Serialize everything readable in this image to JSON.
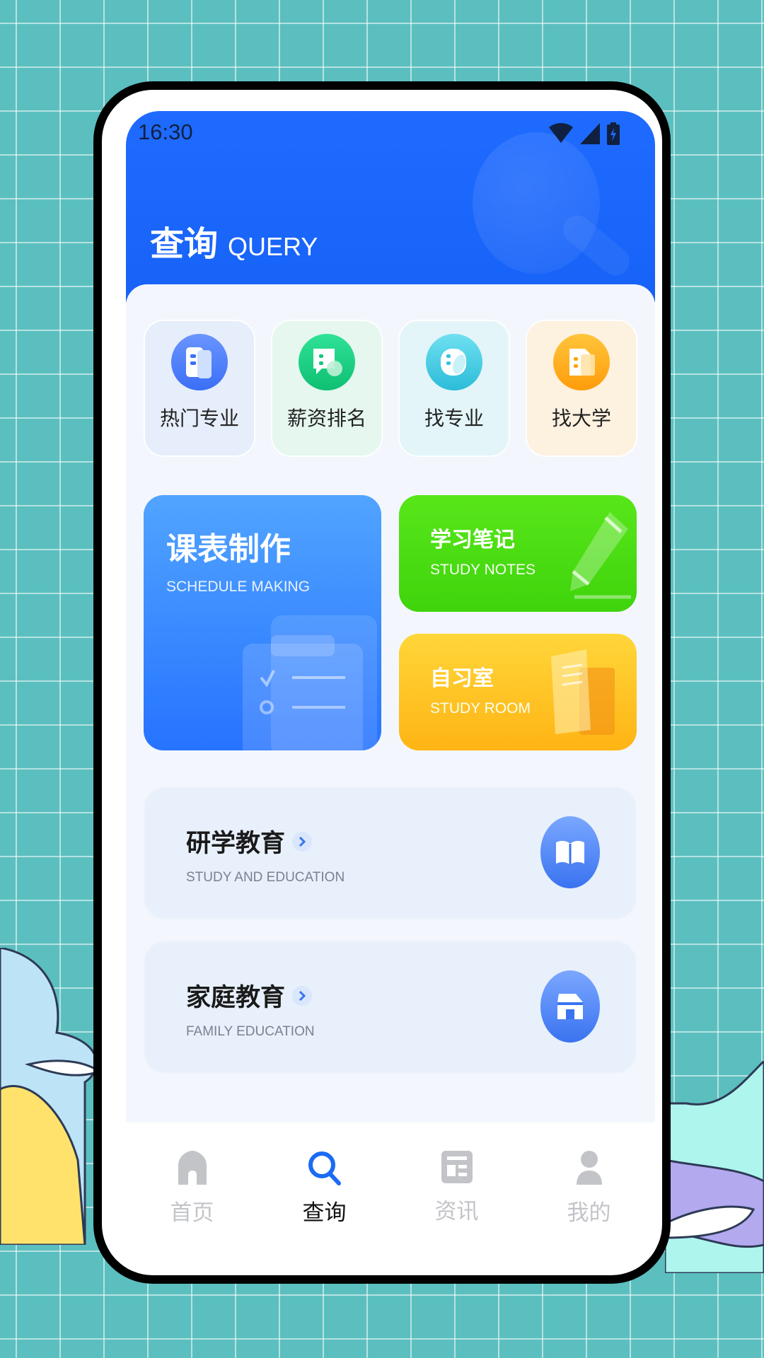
{
  "status_bar": {
    "time": "16:30",
    "icons": [
      "wifi-icon",
      "signal-icon",
      "battery-icon"
    ]
  },
  "header": {
    "title_cn": "查询",
    "title_en": "QUERY"
  },
  "quick_actions": [
    {
      "label": "热门专业",
      "icon": "book-icon",
      "color": "#3b6ff5",
      "bg": "#e6eefb"
    },
    {
      "label": "薪资排名",
      "icon": "chat-icon",
      "color": "#12c97a",
      "bg": "#e5f7ee"
    },
    {
      "label": "找专业",
      "icon": "capsule-icon",
      "color": "#34c6e0",
      "bg": "#e3f5f8"
    },
    {
      "label": "找大学",
      "icon": "building-icon",
      "color": "#ffa20f",
      "bg": "#fdf1df"
    }
  ],
  "features": {
    "schedule": {
      "title": "课表制作",
      "subtitle": "SCHEDULE MAKING",
      "icon": "clipboard-icon"
    },
    "notes": {
      "title": "学习笔记",
      "subtitle": "STUDY NOTES",
      "icon": "pencil-icon"
    },
    "room": {
      "title": "自习室",
      "subtitle": "STUDY ROOM",
      "icon": "door-icon"
    }
  },
  "list": [
    {
      "title": "研学教育",
      "subtitle": "STUDY AND EDUCATION",
      "icon": "open-book-icon"
    },
    {
      "title": "家庭教育",
      "subtitle": "FAMILY EDUCATION",
      "icon": "house-icon"
    }
  ],
  "tabs": [
    {
      "label": "首页",
      "icon": "home-icon",
      "active": false
    },
    {
      "label": "查询",
      "icon": "search-icon",
      "active": true
    },
    {
      "label": "资讯",
      "icon": "news-icon",
      "active": false
    },
    {
      "label": "我的",
      "icon": "user-icon",
      "active": false
    }
  ],
  "colors": {
    "accent": "#1f6bff",
    "active_tab": "#1a6cf5",
    "inactive_tab": "#c2c4c8"
  }
}
